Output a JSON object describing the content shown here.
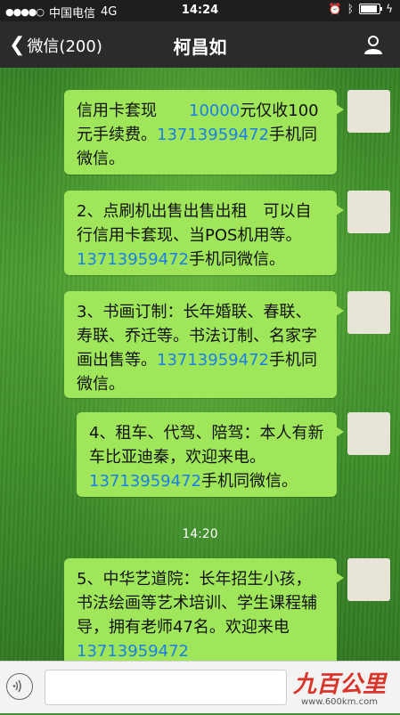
{
  "status": {
    "carrier": "中国电信",
    "network": "4G",
    "time": "14:24"
  },
  "nav": {
    "back_label": "微信(200)",
    "title": "柯昌如"
  },
  "messages": [
    {
      "text": "信用卡套现　　",
      "phone": "10000",
      "after": "元仅收100元手续费。",
      "phone2": "13713959472",
      "after2": "手机同微信。"
    },
    {
      "text": "2、点刷机出售出售出租　可以自行信用卡套现、当POS机用等。",
      "phone": "13713959472",
      "after": "手机同微信。"
    },
    {
      "text": "3、书画订制：长年婚联、春联、寿联、乔迁等。书法订制、名家字画出售等。",
      "phone": "13713959472",
      "after": "手机同微信。"
    },
    {
      "text": "4、租车、代驾、陪驾：本人有新车比亚迪秦，欢迎来电。",
      "phone": "13713959472",
      "after": "手机同微信。"
    },
    {
      "text": "5、中华艺道院：长年招生小孩，书法绘画等艺术培训、学生课程辅导，拥有老师47名。欢迎来电",
      "phone": "13713959472",
      "after": ""
    }
  ],
  "timestamp": "14:20",
  "watermark": {
    "logo": "九百公里",
    "url": "www.600km.com"
  },
  "colors": {
    "bubble": "#9fe65b",
    "phone_link": "#1a7fe6",
    "navbar": "#2b2b2b"
  }
}
